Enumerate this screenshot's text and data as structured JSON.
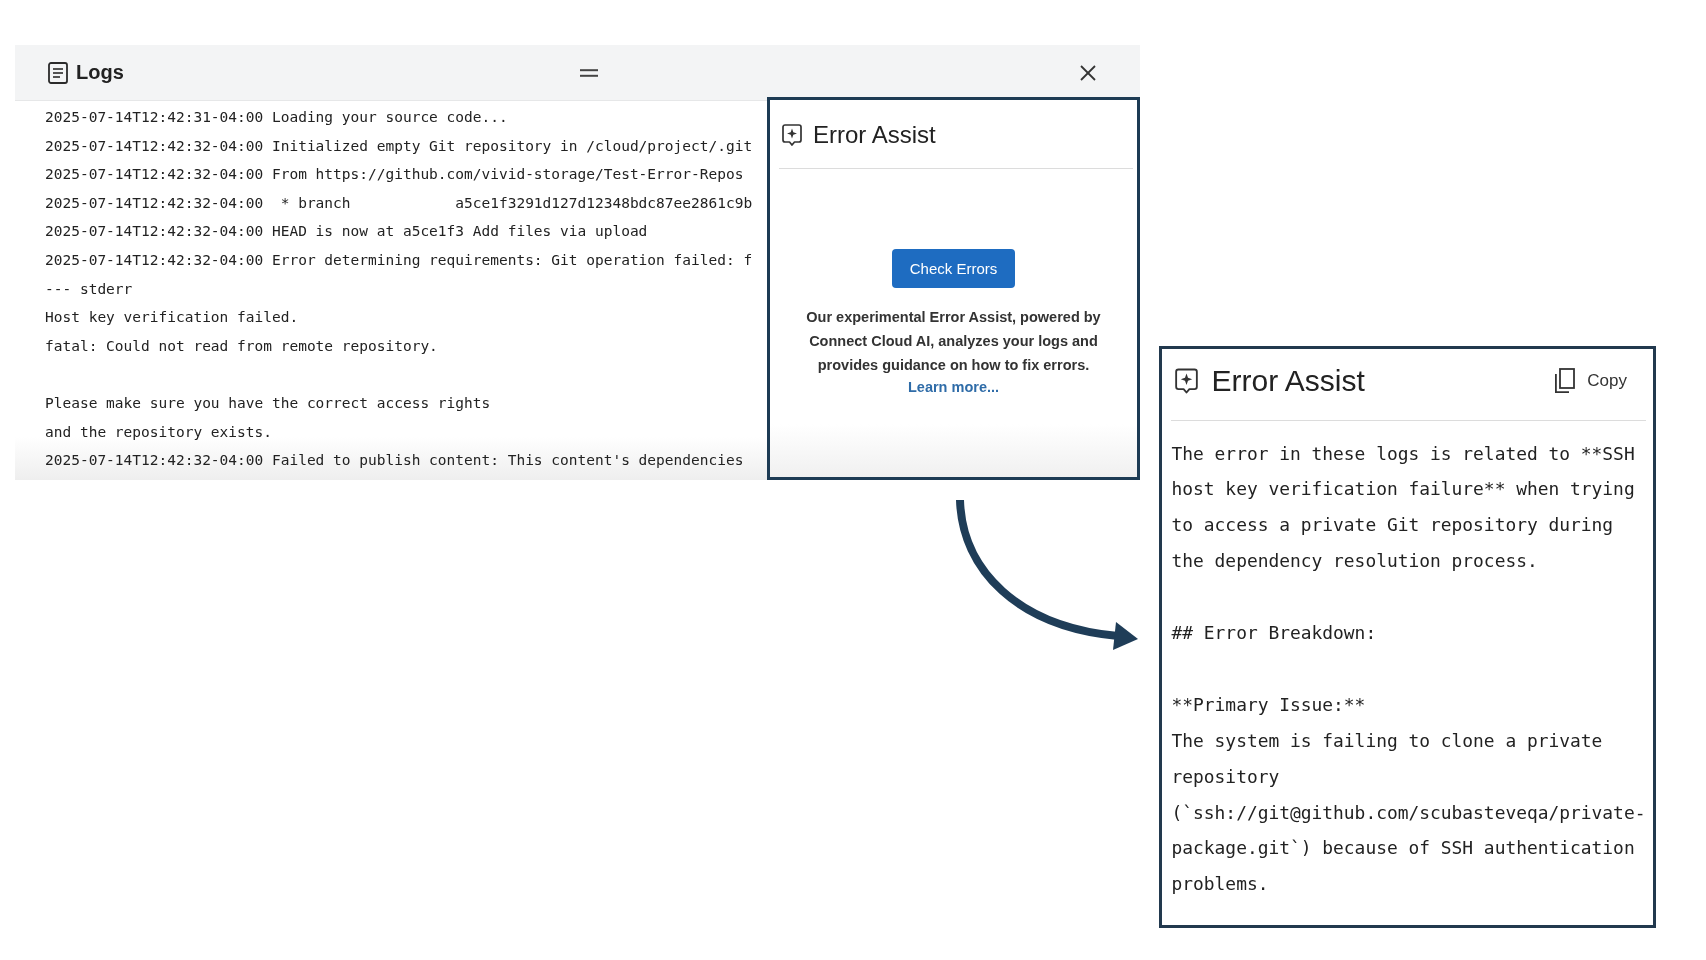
{
  "logs_panel": {
    "title": "Logs",
    "blocks": [
      {
        "lines": [
          "2025-07-14T12:42:31-04:00 Loading your source code...",
          "2025-07-14T12:42:32-04:00 Initialized empty Git repository in /cloud/project/.git",
          "2025-07-14T12:42:32-04:00 From https://github.com/vivid-storage/Test-Error-Repos",
          "2025-07-14T12:42:32-04:00  * branch            a5ce1f3291d127d12348bdc87ee2861c9b",
          "2025-07-14T12:42:32-04:00 HEAD is now at a5ce1f3 Add files via upload",
          "2025-07-14T12:42:32-04:00 Error determining requirements: Git operation failed: f",
          "--- stderr",
          "Host key verification failed.",
          "fatal: Could not read from remote repository."
        ]
      },
      {
        "lines": [
          "Please make sure you have the correct access rights",
          "and the repository exists.",
          "2025-07-14T12:42:32-04:00 Failed to publish content: This content's dependencies"
        ]
      }
    ]
  },
  "error_assist_popup": {
    "title": "Error Assist",
    "check_button": "Check Errors",
    "description": "Our experimental Error Assist, powered by Connect Cloud AI, analyzes your logs and provides guidance on how to fix errors.",
    "link": "Learn more..."
  },
  "error_assist_result": {
    "title": "Error Assist",
    "copy_button": "Copy",
    "blocks": [
      {
        "paragraphs": [
          "The error in these logs is related to **SSH host key verification failure** when trying to access a private Git repository during the dependency resolution process."
        ]
      },
      {
        "paragraphs": [
          "## Error Breakdown:"
        ]
      },
      {
        "paragraphs": [
          "**Primary Issue:**",
          "The system is failing to clone a private repository (`ssh://git@github.com/scubasteveqa/private-package.git`) because of SSH authentication problems."
        ]
      }
    ]
  }
}
